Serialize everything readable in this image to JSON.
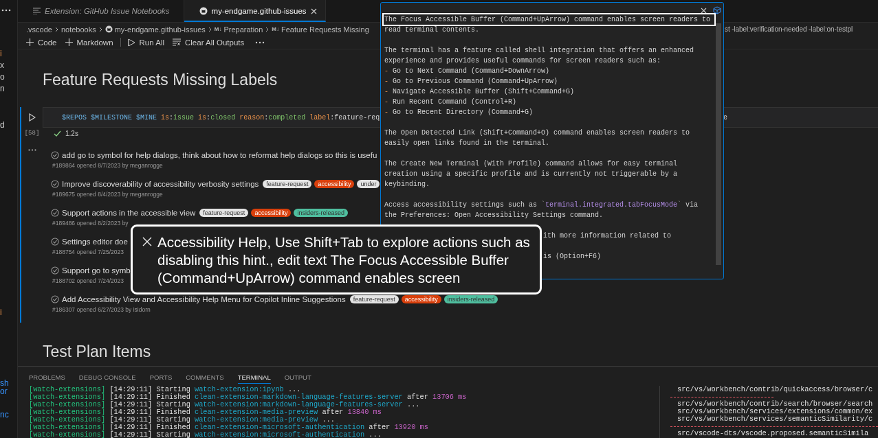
{
  "sidebar_fragments": [
    [
      {
        "text": "i",
        "kind": "modified"
      },
      {
        "text": "x",
        "kind": "plain"
      },
      {
        "text": "o",
        "kind": "plain"
      },
      {
        "text": "n",
        "kind": "plain"
      }
    ],
    [
      {
        "text": "d",
        "kind": "plain"
      }
    ],
    [
      {
        "text": "i",
        "kind": "modified"
      }
    ],
    [
      {
        "text": "sh",
        "kind": "link"
      },
      {
        "text": "or",
        "kind": "link"
      }
    ],
    [
      {
        "text": "nc",
        "kind": "link"
      }
    ]
  ],
  "tabs": [
    {
      "label": "Extension: GitHub Issue Notebooks",
      "kind": "preview",
      "selected": false
    },
    {
      "label": "my-endgame.github-issues",
      "kind": "github",
      "selected": true
    }
  ],
  "breadcrumbs": [
    {
      "label": ".vscode",
      "kind": "plain"
    },
    {
      "label": "notebooks",
      "kind": "plain"
    },
    {
      "label": "my-endgame.github-issues",
      "kind": "github"
    },
    {
      "label": "Preparation",
      "kind": "markdown",
      "icon": "M↓"
    },
    {
      "label": "Feature Requests Missing",
      "kind": "markdown",
      "icon": "M↓"
    }
  ],
  "breadcrumb_tail": "st -label:verification-needed -label:on-testpl",
  "toolbar": [
    {
      "label": "Code",
      "kind": "add"
    },
    {
      "label": "Markdown",
      "kind": "add"
    },
    {
      "label": "Run All",
      "kind": "run"
    },
    {
      "label": "Clear All Outputs",
      "kind": "clear"
    }
  ],
  "heading": "Feature Requests Missing Labels",
  "cell": {
    "tokens": [
      {
        "text": "$REPOS ",
        "kind": "var"
      },
      {
        "text": "$MILESTONE ",
        "kind": "var"
      },
      {
        "text": "$MINE ",
        "kind": "var"
      },
      {
        "text": "is",
        "kind": "key"
      },
      {
        "text": ":",
        "kind": "plain"
      },
      {
        "text": "issue ",
        "kind": "value"
      },
      {
        "text": "is",
        "kind": "key"
      },
      {
        "text": ":",
        "kind": "plain"
      },
      {
        "text": "closed ",
        "kind": "value"
      },
      {
        "text": "reason",
        "kind": "key"
      },
      {
        "text": ":",
        "kind": "plain"
      },
      {
        "text": "completed ",
        "kind": "value"
      },
      {
        "text": "label",
        "kind": "key"
      },
      {
        "text": ":feature-req",
        "kind": "plain"
      }
    ],
    "tail": "e",
    "execution_count": "[58]",
    "duration": "1.2s"
  },
  "issues": [
    {
      "title": "add go to symbol for help dialogs, think about how to reformat help dialogs so this is usefu",
      "meta": "#189864 opened 8/7/2023 by meganrogge"
    },
    {
      "title": "Improve discoverability of accessibility verbosity settings",
      "labels": [
        {
          "text": "feature-request",
          "color": "#e4e4e4"
        },
        {
          "text": "accessibility",
          "color": "#d93f0b"
        },
        {
          "text": "under",
          "color": "#e4e4e4"
        }
      ],
      "meta": "#189675 opened 8/4/2023 by meganrogge"
    },
    {
      "title": "Support actions in the accessible view",
      "labels": [
        {
          "text": "feature-request",
          "color": "#e4e4e4"
        },
        {
          "text": "accessibility",
          "color": "#d93f0b"
        },
        {
          "text": "insiders-released",
          "color": "#4fbf9f"
        }
      ],
      "meta": "#189486 opened 8/2/2023 by"
    },
    {
      "title": "Settings editor doe",
      "meta": "#188754 opened 7/25/2023"
    },
    {
      "title": "Support go to symb",
      "meta": "#188702 opened 7/24/2023"
    },
    {
      "title": "Add Accessibility View and Accessibility Help Menu for Copilot Inline Suggestions",
      "labels": [
        {
          "text": "feature-request",
          "color": "#e4e4e4"
        },
        {
          "text": "accessibility",
          "color": "#d93f0b"
        },
        {
          "text": "insiders-released",
          "color": "#4fbf9f"
        }
      ],
      "meta": "#186307 opened 6/27/2023 by isidorn"
    }
  ],
  "second_heading": "Test Plan Items",
  "panel": {
    "tabs": [
      {
        "label": "PROBLEMS",
        "selected": false
      },
      {
        "label": "DEBUG CONSOLE",
        "selected": false
      },
      {
        "label": "PORTS",
        "selected": false
      },
      {
        "label": "COMMENTS",
        "selected": false
      },
      {
        "label": "TERMINAL",
        "selected": true
      },
      {
        "label": "OUTPUT",
        "selected": false
      }
    ],
    "terminal_lines": [
      [
        {
          "text": "[watch-extensions]",
          "kind": "tag"
        },
        {
          "text": " [14:29:11] Starting ",
          "kind": "plain"
        },
        {
          "text": "watch-extension:ipynb",
          "kind": "task"
        },
        {
          "text": " ...",
          "kind": "plain"
        }
      ],
      [
        {
          "text": "[watch-extensions]",
          "kind": "tag"
        },
        {
          "text": " [14:29:11] Finished ",
          "kind": "plain"
        },
        {
          "text": "clean-extension-markdown-language-features-server",
          "kind": "task"
        },
        {
          "text": " after ",
          "kind": "plain"
        },
        {
          "text": "13706 ms",
          "kind": "num"
        }
      ],
      [
        {
          "text": "[watch-extensions]",
          "kind": "tag"
        },
        {
          "text": " [14:29:11] Starting ",
          "kind": "plain"
        },
        {
          "text": "watch-extension:markdown-language-features-server",
          "kind": "task"
        },
        {
          "text": " ...",
          "kind": "plain"
        }
      ],
      [
        {
          "text": "[watch-extensions]",
          "kind": "tag"
        },
        {
          "text": " [14:29:11] Finished ",
          "kind": "plain"
        },
        {
          "text": "clean-extension-media-preview",
          "kind": "task"
        },
        {
          "text": " after ",
          "kind": "plain"
        },
        {
          "text": "13840 ms",
          "kind": "num"
        }
      ],
      [
        {
          "text": "[watch-extensions]",
          "kind": "tag"
        },
        {
          "text": " [14:29:11] Starting ",
          "kind": "plain"
        },
        {
          "text": "watch-extension:media-preview",
          "kind": "task"
        },
        {
          "text": " ...",
          "kind": "plain"
        }
      ],
      [
        {
          "text": "[watch-extensions]",
          "kind": "tag"
        },
        {
          "text": " [14:29:11] Finished ",
          "kind": "plain"
        },
        {
          "text": "clean-extension-microsoft-authentication",
          "kind": "task"
        },
        {
          "text": " after ",
          "kind": "plain"
        },
        {
          "text": "13920 ms",
          "kind": "num"
        }
      ],
      [
        {
          "text": "[watch-extensions]",
          "kind": "tag"
        },
        {
          "text": " [14:29:11] Starting ",
          "kind": "plain"
        },
        {
          "text": "watch-extension:microsoft-authentication",
          "kind": "task"
        },
        {
          "text": " ...",
          "kind": "plain"
        }
      ]
    ],
    "split_lines": [
      {
        "kind": "path",
        "text": "src/vs/workbench/contrib/quickaccess/browser/c"
      },
      {
        "kind": "short-rule"
      },
      {
        "kind": "path",
        "text": "src/vs/workbench/contrib/search/browser/search"
      },
      {
        "kind": "path",
        "text": "src/vs/workbench/services/extensions/common/ex"
      },
      {
        "kind": "path",
        "text": "src/vs/workbench/services/semanticSimilarity/c"
      },
      {
        "kind": "rule"
      },
      {
        "kind": "path",
        "text": "src/vscode-dts/vscode.proposed.semanticSimila"
      }
    ]
  },
  "help": {
    "lines": [
      {
        "kind": "text",
        "focused": true,
        "segments": [
          {
            "text": "The Focus Accessible Buffer (Command+UpArrow) command enables screen readers to",
            "kind": "plain"
          }
        ]
      },
      {
        "kind": "text",
        "focused": false,
        "segments": [
          {
            "text": "read terminal contents.",
            "kind": "plain"
          }
        ]
      },
      {
        "kind": "blank"
      },
      {
        "kind": "text",
        "focused": false,
        "segments": [
          {
            "text": "The terminal has a feature called shell integration that offers an enhanced",
            "kind": "plain"
          }
        ]
      },
      {
        "kind": "text",
        "focused": false,
        "segments": [
          {
            "text": "experience and provides useful commands for screen readers such as:",
            "kind": "plain"
          }
        ]
      },
      {
        "kind": "text",
        "focused": false,
        "segments": [
          {
            "text": "-",
            "kind": "dash"
          },
          {
            "text": " Go to Next Command (Command+DownArrow)",
            "kind": "plain"
          }
        ]
      },
      {
        "kind": "text",
        "focused": false,
        "segments": [
          {
            "text": "-",
            "kind": "dash"
          },
          {
            "text": " Go to Previous Command (Command+UpArrow)",
            "kind": "plain"
          }
        ]
      },
      {
        "kind": "text",
        "focused": false,
        "segments": [
          {
            "text": "-",
            "kind": "dash"
          },
          {
            "text": " Navigate Accessible Buffer (Shift+Command+G)",
            "kind": "plain"
          }
        ]
      },
      {
        "kind": "text",
        "focused": false,
        "segments": [
          {
            "text": "-",
            "kind": "dash"
          },
          {
            "text": " Run Recent Command (Control+R)",
            "kind": "plain"
          }
        ]
      },
      {
        "kind": "text",
        "focused": false,
        "segments": [
          {
            "text": "-",
            "kind": "dash"
          },
          {
            "text": " Go to Recent Directory (Command+G)",
            "kind": "plain"
          }
        ]
      },
      {
        "kind": "blank"
      },
      {
        "kind": "text",
        "focused": false,
        "segments": [
          {
            "text": "The Open Detected Link (Shift+Command+O) command enables screen readers to",
            "kind": "plain"
          }
        ]
      },
      {
        "kind": "text",
        "focused": false,
        "segments": [
          {
            "text": "easily open links found in the terminal.",
            "kind": "plain"
          }
        ]
      },
      {
        "kind": "blank"
      },
      {
        "kind": "text",
        "focused": false,
        "segments": [
          {
            "text": "The Create New Terminal (With Profile) command allows for easy terminal",
            "kind": "plain"
          }
        ]
      },
      {
        "kind": "text",
        "focused": false,
        "segments": [
          {
            "text": "creation using a specific profile and is currently not triggerable by a",
            "kind": "plain"
          }
        ]
      },
      {
        "kind": "text",
        "focused": false,
        "segments": [
          {
            "text": "keybinding.",
            "kind": "plain"
          }
        ]
      },
      {
        "kind": "blank"
      },
      {
        "kind": "text",
        "focused": false,
        "segments": [
          {
            "text": "Access accessibility settings such as ",
            "kind": "plain"
          },
          {
            "text": "`",
            "kind": "tick"
          },
          {
            "text": "terminal.integrated.tabFocusMode",
            "kind": "code"
          },
          {
            "text": "`",
            "kind": "tick"
          },
          {
            "text": " via",
            "kind": "plain"
          }
        ]
      },
      {
        "kind": "text",
        "focused": false,
        "segments": [
          {
            "text": "the Preferences: Open Accessibility Settings command.",
            "kind": "plain"
          }
        ]
      },
      {
        "kind": "blank"
      },
      {
        "kind": "covered",
        "focused": false,
        "segments": [
          {
            "text": "ith more information related to",
            "kind": "plain"
          }
        ]
      },
      {
        "kind": "blank"
      },
      {
        "kind": "covered",
        "focused": false,
        "segments": [
          {
            "text": "is (Option+F6)",
            "kind": "plain"
          }
        ]
      }
    ]
  },
  "tooltip": {
    "text": "Accessibility Help, Use Shift+Tab to explore actions such as disabling this hint., edit text The Focus Accessible Buffer (Command+UpArrow) command enables screen"
  }
}
